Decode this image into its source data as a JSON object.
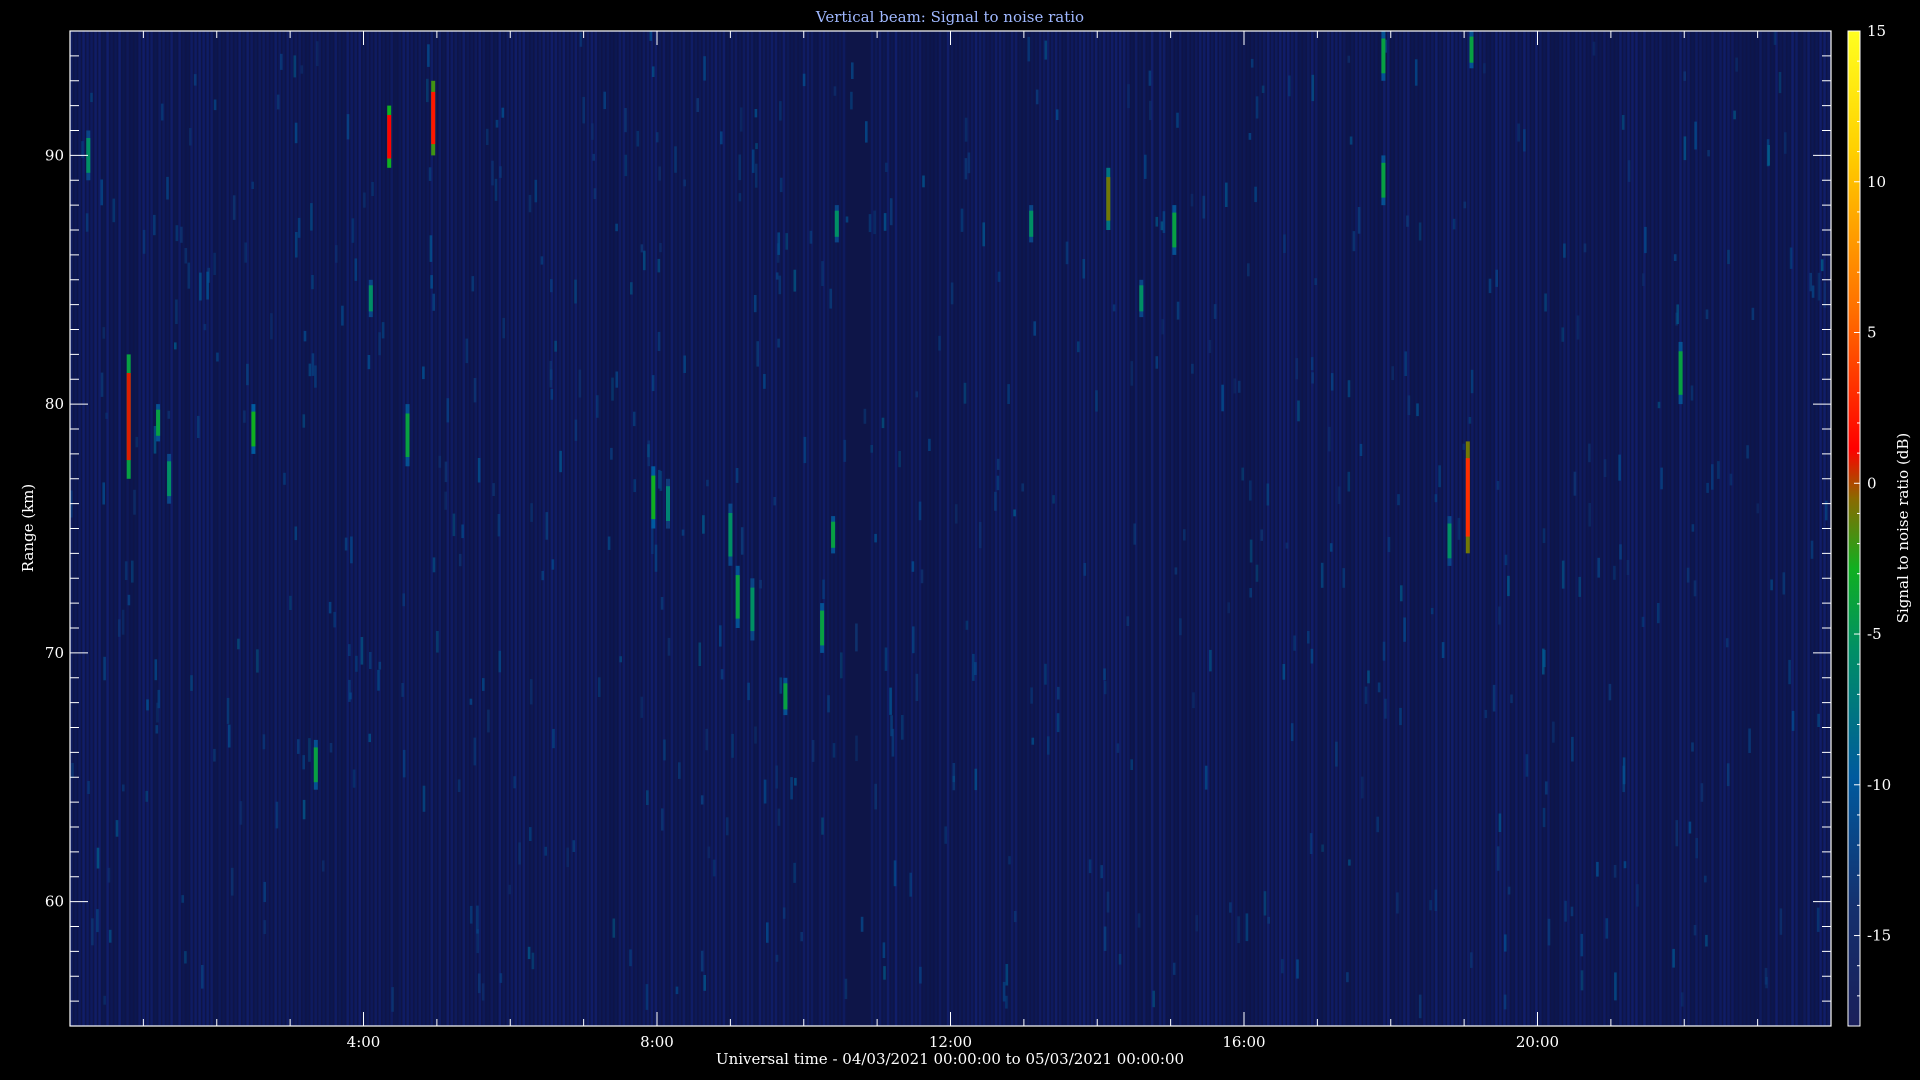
{
  "chart_data": {
    "type": "heatmap",
    "title": "Vertical beam: Signal to noise ratio",
    "xlabel": "Universal time - 04/03/2021 00:00:00 to 05/03/2021 00:00:00",
    "ylabel": "Range (km)",
    "colorbar_label": "Signal to noise ratio (dB)",
    "x_range_hours": [
      0,
      24
    ],
    "x_ticks": [
      {
        "hour": 4,
        "label": "4:00"
      },
      {
        "hour": 8,
        "label": "8:00"
      },
      {
        "hour": 12,
        "label": "12:00"
      },
      {
        "hour": 16,
        "label": "16:00"
      },
      {
        "hour": 20,
        "label": "20:00"
      }
    ],
    "y_range_km": [
      55,
      95
    ],
    "y_ticks": [
      {
        "value": 60,
        "label": "60"
      },
      {
        "value": 70,
        "label": "70"
      },
      {
        "value": 80,
        "label": "80"
      },
      {
        "value": 90,
        "label": "90"
      }
    ],
    "colorbar_range_db": [
      -18,
      15
    ],
    "colorbar_ticks": [
      {
        "value": 15,
        "label": "15"
      },
      {
        "value": 10,
        "label": "10"
      },
      {
        "value": 5,
        "label": "5"
      },
      {
        "value": 0,
        "label": "0"
      },
      {
        "value": -5,
        "label": "-5"
      },
      {
        "value": -10,
        "label": "-10"
      },
      {
        "value": -15,
        "label": "-15"
      }
    ],
    "background_db": -15,
    "notable_echoes": [
      {
        "time_h": 0.25,
        "range_from_km": 89,
        "range_to_km": 91,
        "snr_db": -7
      },
      {
        "time_h": 0.8,
        "range_from_km": 77,
        "range_to_km": 82,
        "snr_db": 0
      },
      {
        "time_h": 1.2,
        "range_from_km": 78.5,
        "range_to_km": 80,
        "snr_db": -6
      },
      {
        "time_h": 1.35,
        "range_from_km": 76,
        "range_to_km": 78,
        "snr_db": -7
      },
      {
        "time_h": 2.5,
        "range_from_km": 78,
        "range_to_km": 80,
        "snr_db": -5
      },
      {
        "time_h": 3.35,
        "range_from_km": 64.5,
        "range_to_km": 66.5,
        "snr_db": -6
      },
      {
        "time_h": 4.1,
        "range_from_km": 83.5,
        "range_to_km": 85,
        "snr_db": -7
      },
      {
        "time_h": 4.35,
        "range_from_km": 89.5,
        "range_to_km": 92,
        "snr_db": 1
      },
      {
        "time_h": 4.6,
        "range_from_km": 77.5,
        "range_to_km": 80,
        "snr_db": -6
      },
      {
        "time_h": 4.95,
        "range_from_km": 90,
        "range_to_km": 93,
        "snr_db": 2
      },
      {
        "time_h": 7.95,
        "range_from_km": 75,
        "range_to_km": 77.5,
        "snr_db": -5
      },
      {
        "time_h": 8.15,
        "range_from_km": 75,
        "range_to_km": 77,
        "snr_db": -8
      },
      {
        "time_h": 9.0,
        "range_from_km": 73.5,
        "range_to_km": 76,
        "snr_db": -7
      },
      {
        "time_h": 9.1,
        "range_from_km": 71,
        "range_to_km": 73.5,
        "snr_db": -6
      },
      {
        "time_h": 9.3,
        "range_from_km": 70.5,
        "range_to_km": 73,
        "snr_db": -7
      },
      {
        "time_h": 9.75,
        "range_from_km": 67.5,
        "range_to_km": 69,
        "snr_db": -6
      },
      {
        "time_h": 10.25,
        "range_from_km": 70,
        "range_to_km": 72,
        "snr_db": -6
      },
      {
        "time_h": 10.4,
        "range_from_km": 74,
        "range_to_km": 75.5,
        "snr_db": -6
      },
      {
        "time_h": 10.45,
        "range_from_km": 86.5,
        "range_to_km": 88,
        "snr_db": -7
      },
      {
        "time_h": 13.1,
        "range_from_km": 86.5,
        "range_to_km": 88,
        "snr_db": -7
      },
      {
        "time_h": 14.15,
        "range_from_km": 87,
        "range_to_km": 89.5,
        "snr_db": -3
      },
      {
        "time_h": 14.6,
        "range_from_km": 83.5,
        "range_to_km": 85,
        "snr_db": -7
      },
      {
        "time_h": 15.05,
        "range_from_km": 86,
        "range_to_km": 88,
        "snr_db": -6
      },
      {
        "time_h": 17.9,
        "range_from_km": 93,
        "range_to_km": 95,
        "snr_db": -6
      },
      {
        "time_h": 17.9,
        "range_from_km": 88,
        "range_to_km": 90,
        "snr_db": -6
      },
      {
        "time_h": 18.8,
        "range_from_km": 73.5,
        "range_to_km": 75.5,
        "snr_db": -7
      },
      {
        "time_h": 19.05,
        "range_from_km": 74,
        "range_to_km": 78.5,
        "snr_db": 3
      },
      {
        "time_h": 19.1,
        "range_from_km": 93.5,
        "range_to_km": 95,
        "snr_db": -6
      },
      {
        "time_h": 21.95,
        "range_from_km": 80,
        "range_to_km": 82.5,
        "snr_db": -6
      }
    ]
  }
}
